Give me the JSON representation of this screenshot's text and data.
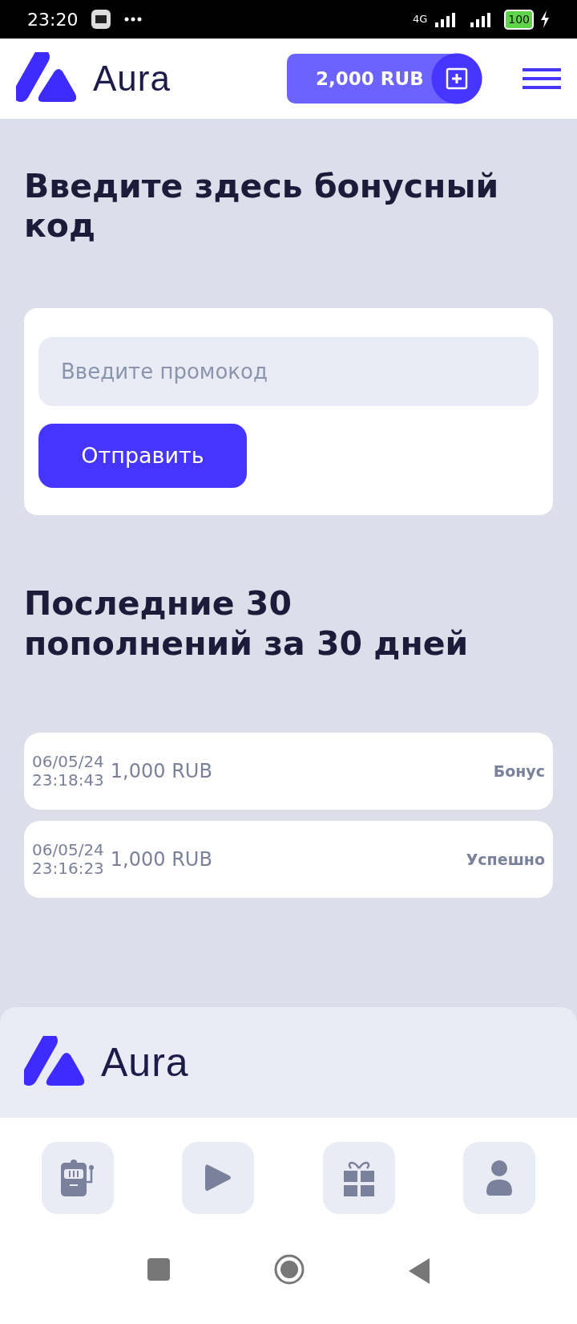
{
  "status_bar": {
    "time": "23:20",
    "network": "4G",
    "battery": "100"
  },
  "header": {
    "brand": "Aura",
    "balance": "2,000 RUB"
  },
  "bonus": {
    "title": "Введите здесь бонусный код",
    "placeholder": "Введите промокод",
    "submit": "Отправить"
  },
  "history": {
    "title": "Последние 30 пополнений за 30 дней",
    "rows": [
      {
        "date": "06/05/24",
        "time": "23:18:43",
        "amount": "1,000 RUB",
        "status": "Бонус"
      },
      {
        "date": "06/05/24",
        "time": "23:16:23",
        "amount": "1,000 RUB",
        "status": "Успешно"
      }
    ]
  },
  "footer": {
    "brand": "Aura"
  },
  "bottom_nav": [
    {
      "kind": "slots"
    },
    {
      "kind": "play"
    },
    {
      "kind": "gift"
    },
    {
      "kind": "profile"
    }
  ]
}
